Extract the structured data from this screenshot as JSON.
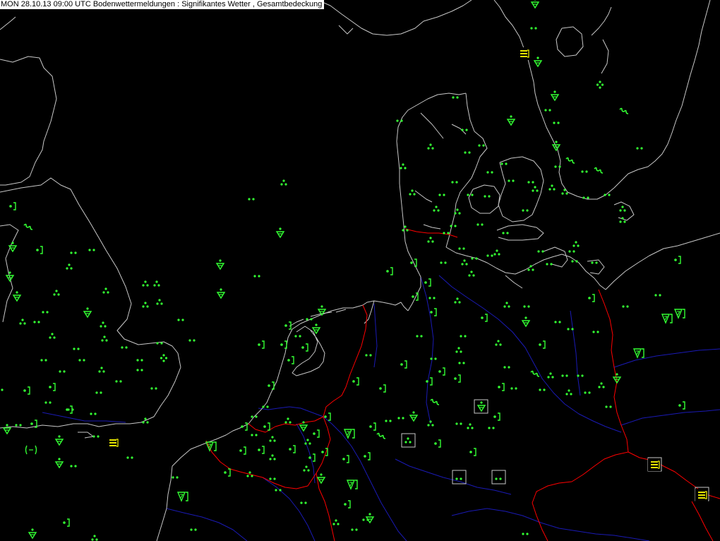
{
  "header": {
    "title": "MON 28.10.13 09:00 UTC  Bodenwettermeldungen :  Signifikantes Wetter , Gesamtbedeckung"
  },
  "colors": {
    "background": "#000000",
    "coastline": "#c8c8c8",
    "border": "#ff0000",
    "river": "#1a1ab4",
    "symbol": "#33ff33",
    "warning": "#ffff00",
    "station_box": "#c8c8c8"
  },
  "legend": {
    "drizzle": "drizzle-icon",
    "rain_shower": "rain-shower-icon",
    "rain": "rain-icon",
    "rain_heavy": "heavy-rain-icon",
    "recent_rain": "recent-rain-icon",
    "thunderstorm_recent": "thunderstorm-recent-icon",
    "fog_band": "fog-icon",
    "haze": "haze-icon",
    "mist": "mist-icon",
    "drizzle_shower": "drizzle-shower-icon"
  }
}
